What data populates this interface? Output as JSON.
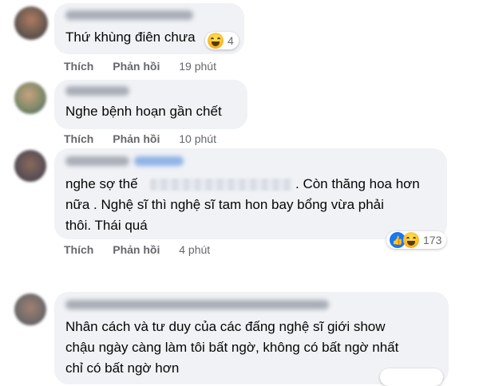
{
  "colors": {
    "bubble": "#f0f2f5",
    "text": "#050505",
    "meta": "#65676b",
    "like_blue": "#1877f2",
    "haha_yellow": "#f7b125"
  },
  "actions": {
    "like": "Thích",
    "reply": "Phản hồi"
  },
  "comments": [
    {
      "lines": [
        "Thứ khùng điên chưa"
      ],
      "time": "19 phút",
      "reaction": {
        "icons": [
          "haha-icon"
        ],
        "count": "4"
      }
    },
    {
      "lines": [
        "Nghe bệnh hoạn gần chết"
      ],
      "time": "10 phút",
      "reaction": null
    },
    {
      "lines": [
        "nghe sợ thế",
        ". Còn thăng hoa hơn",
        "nữa . Nghệ sĩ thì nghệ sĩ tam hon bay bổng vừa phải",
        "thôi. Thái quá"
      ],
      "time": "4 phút",
      "reaction": {
        "icons": [
          "like-icon",
          "haha-icon"
        ],
        "count": "173"
      }
    },
    {
      "lines": [
        "Nhân cách và tư duy của các đấng nghệ sĩ giới show",
        "chậu ngày càng làm tôi bất ngờ, không có bất ngờ nhất",
        "chỉ có bất ngờ hơn"
      ],
      "time": "",
      "reaction": null
    }
  ]
}
